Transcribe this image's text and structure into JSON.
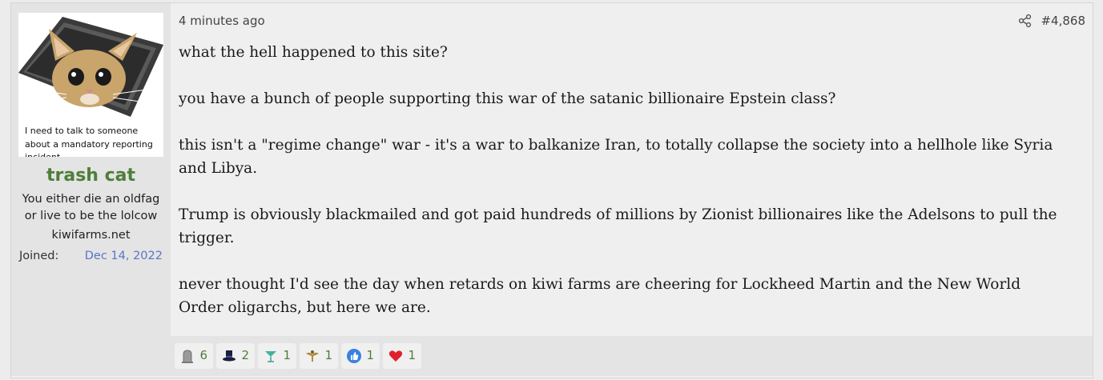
{
  "post": {
    "user": {
      "avatar_caption": "I need to talk to someone about a mandatory reporting incident",
      "username": "trash cat",
      "title": "You either die an oldfag or live to be the lolcow",
      "site": "kiwifarms.net",
      "joined_label": "Joined:",
      "joined_date": "Dec 14, 2022",
      "username_color": "#4e7e3a",
      "date_color": "#5b75c8"
    },
    "meta": {
      "time": "4 minutes ago",
      "number": "#4,868",
      "share_icon": "share-icon"
    },
    "content": [
      "what the hell happened to this site?",
      "you have a bunch of people supporting this war of the satanic billionaire Epstein class?",
      "this isn't a \"regime change\" war - it's a war to balkanize Iran, to totally collapse the society into a hellhole like Syria and Libya.",
      "Trump is obviously blackmailed and got paid hundreds of millions by Zionist billionaires like the Adelsons to pull the trigger.",
      "never thought I'd see the day when retards on kiwi farms are cheering for Lockheed Martin and the New World Order oligarchs, but here we are."
    ],
    "reactions": [
      {
        "icon": "tombstone-icon",
        "count": "6"
      },
      {
        "icon": "top-hat-icon",
        "count": "2"
      },
      {
        "icon": "cocktail-icon",
        "count": "1"
      },
      {
        "icon": "eagle-icon",
        "count": "1"
      },
      {
        "icon": "thumbs-up-icon",
        "count": "1"
      },
      {
        "icon": "heart-icon",
        "count": "1"
      }
    ]
  }
}
